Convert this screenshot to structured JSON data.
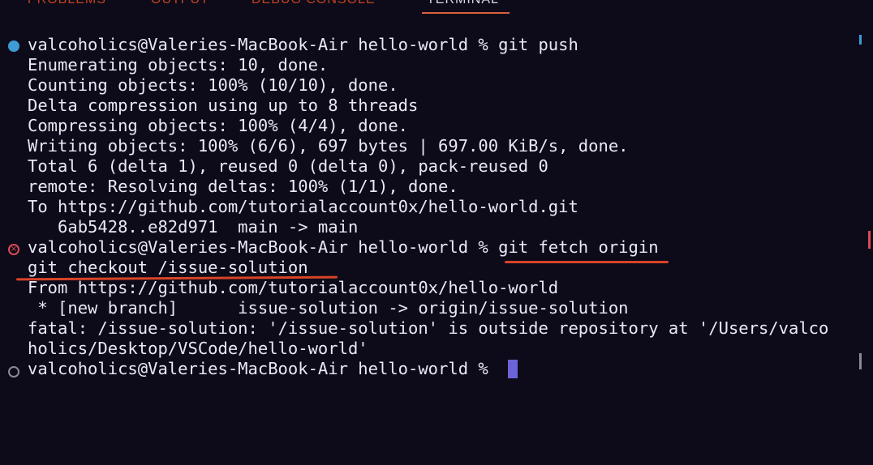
{
  "panel": {
    "tabs": [
      {
        "label": "PROBLEMS"
      },
      {
        "label": "OUTPUT"
      },
      {
        "label": "DEBUG CONSOLE"
      },
      {
        "label": "TERMINAL"
      }
    ]
  },
  "terminal": {
    "lines": [
      "valcoholics@Valeries-MacBook-Air hello-world % git push",
      "Enumerating objects: 10, done.",
      "Counting objects: 100% (10/10), done.",
      "Delta compression using up to 8 threads",
      "Compressing objects: 100% (4/4), done.",
      "Writing objects: 100% (6/6), 697 bytes | 697.00 KiB/s, done.",
      "Total 6 (delta 1), reused 0 (delta 0), pack-reused 0",
      "remote: Resolving deltas: 100% (1/1), done.",
      "To https://github.com/tutorialaccount0x/hello-world.git",
      "   6ab5428..e82d971  main -> main",
      "valcoholics@Valeries-MacBook-Air hello-world % git fetch origin",
      "git checkout /issue-solution",
      "From https://github.com/tutorialaccount0x/hello-world",
      " * [new branch]      issue-solution -> origin/issue-solution",
      "fatal: /issue-solution: '/issue-solution' is outside repository at '/Users/valco",
      "holics/Desktop/VSCode/hello-world'",
      "valcoholics@Valeries-MacBook-Air hello-world % "
    ]
  },
  "colors": {
    "background": "#0d0b1a",
    "text": "#eae8f2",
    "success_decoration": "#3d9bd6",
    "error_decoration": "#d94b55",
    "annotation_underline": "#d94326",
    "cursor": "#6b63d6"
  }
}
